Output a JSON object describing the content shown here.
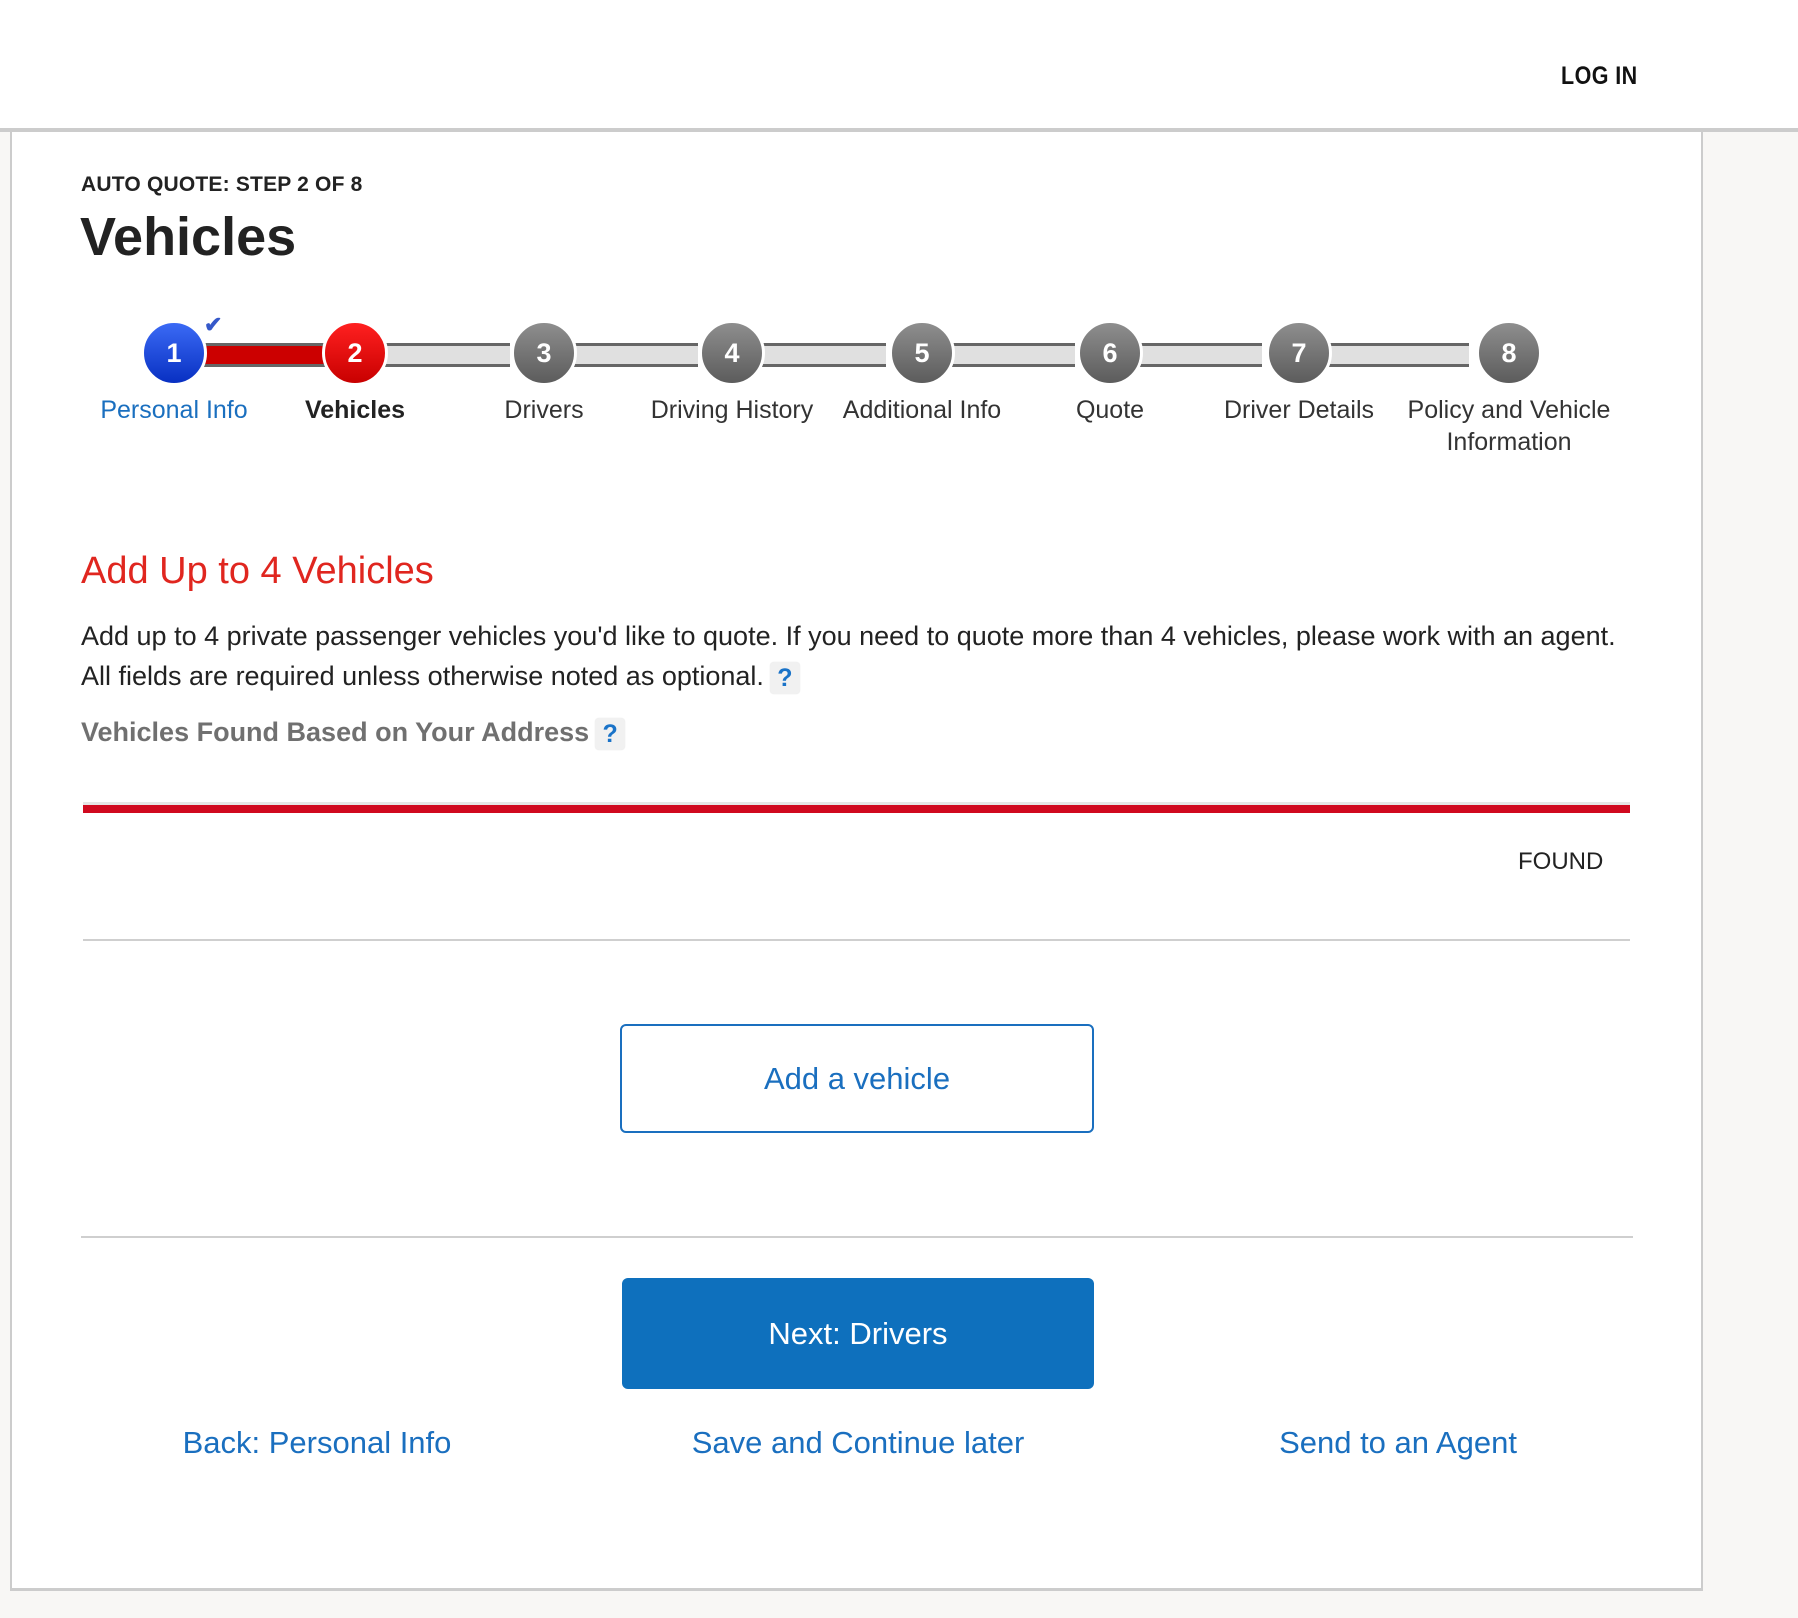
{
  "header": {
    "login_label": "LOG IN"
  },
  "page": {
    "eyebrow": "AUTO QUOTE: STEP 2 OF 8",
    "title": "Vehicles"
  },
  "progress": {
    "current_step": 2,
    "total_steps": 8,
    "steps": [
      {
        "number": "1",
        "label": "Personal Info",
        "state": "completed"
      },
      {
        "number": "2",
        "label": "Vehicles",
        "state": "current"
      },
      {
        "number": "3",
        "label": "Drivers",
        "state": "upcoming"
      },
      {
        "number": "4",
        "label": "Driving History",
        "state": "upcoming"
      },
      {
        "number": "5",
        "label": "Additional Info",
        "state": "upcoming"
      },
      {
        "number": "6",
        "label": "Quote",
        "state": "upcoming"
      },
      {
        "number": "7",
        "label": "Driver Details",
        "state": "upcoming"
      },
      {
        "number": "8",
        "label": "Policy and Vehicle Information",
        "state": "upcoming"
      }
    ],
    "completed_icon": "checkmark-icon"
  },
  "section": {
    "title": "Add Up to 4 Vehicles",
    "description": "Add up to 4 private passenger vehicles you'd like to quote. If you need to quote more than 4 vehicles, please work with an agent. All fields are required unless otherwise noted as optional.",
    "help_icon": "?",
    "found_label": "Vehicles Found Based on Your Address",
    "found_column": "FOUND"
  },
  "actions": {
    "add_vehicle": "Add a vehicle",
    "next": "Next: Drivers",
    "back": "Back: Personal Info",
    "save": "Save and Continue later",
    "send_agent": "Send to an Agent"
  },
  "colors": {
    "accent_blue": "#0e70bd",
    "link_blue": "#1a6fbf",
    "accent_red": "#e0261f",
    "completed_step": "#2050e0",
    "current_step": "#e00000",
    "upcoming_step": "#777777"
  }
}
